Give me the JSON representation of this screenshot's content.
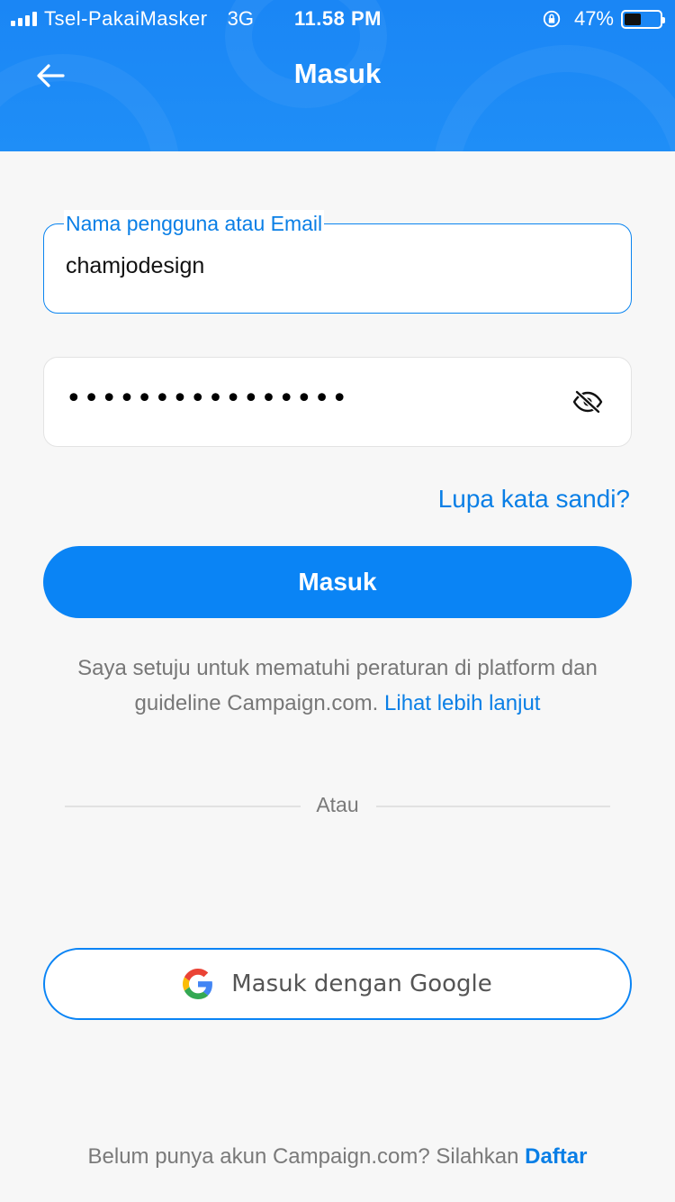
{
  "status_bar": {
    "carrier": "Tsel-PakaiMasker",
    "network": "3G",
    "time": "11.58 PM",
    "battery_percent": "47%",
    "battery_level": 0.47
  },
  "header": {
    "title": "Masuk",
    "back_icon": "arrow-left-icon"
  },
  "form": {
    "username_label": "Nama pengguna atau Email",
    "username_value": "chamjodesign",
    "password_mask": "••••••••••••••••",
    "password_toggle_icon": "eye-off-icon",
    "forgot_label": "Lupa kata sandi?",
    "submit_label": "Masuk"
  },
  "terms": {
    "text": "Saya setuju untuk mematuhi peraturan di platform dan guideline Campaign.com.",
    "link": "Lihat lebih lanjut"
  },
  "divider": {
    "label": "Atau"
  },
  "google": {
    "label": "Masuk dengan Google",
    "icon": "google-icon"
  },
  "footer": {
    "text": "Belum punya akun Campaign.com? Silahkan",
    "link": "Daftar"
  },
  "colors": {
    "primary": "#0a84f5",
    "link": "#0a7fe6",
    "header_bg": "#1a86f5",
    "page_bg": "#f7f7f7"
  }
}
